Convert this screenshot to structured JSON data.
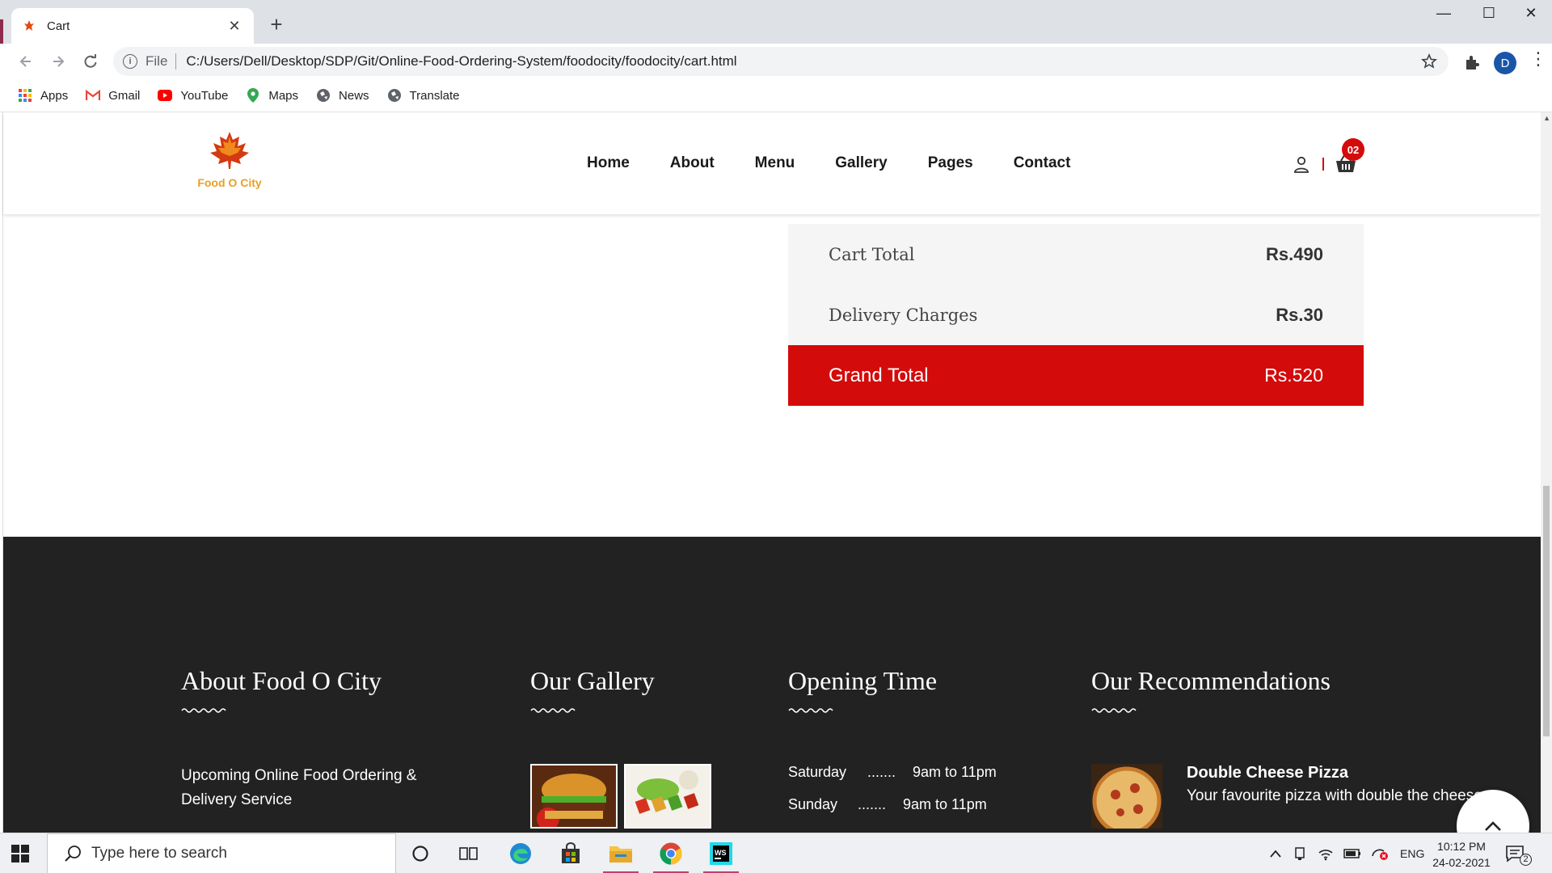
{
  "browser": {
    "tab_title": "Cart",
    "new_tab_label": "+",
    "address_scheme": "File",
    "address_url": "C:/Users/Dell/Desktop/SDP/Git/Online-Food-Ordering-System/foodocity/foodocity/cart.html",
    "profile_initial": "D",
    "bookmarks": [
      {
        "label": "Apps",
        "icon": "apps-grid-icon"
      },
      {
        "label": "Gmail",
        "icon": "gmail-icon"
      },
      {
        "label": "YouTube",
        "icon": "youtube-icon"
      },
      {
        "label": "Maps",
        "icon": "maps-icon"
      },
      {
        "label": "News",
        "icon": "globe-icon"
      },
      {
        "label": "Translate",
        "icon": "globe-icon"
      }
    ]
  },
  "site": {
    "logo_text": "Food O City",
    "nav": [
      "Home",
      "About",
      "Menu",
      "Gallery",
      "Pages",
      "Contact"
    ],
    "cart_count": "02",
    "brand_color": "#d40b0b"
  },
  "cart_totals": {
    "cart_total_label": "Cart Total",
    "cart_total_value": "Rs.490",
    "delivery_label": "Delivery Charges",
    "delivery_value": "Rs.30",
    "grand_label": "Grand Total",
    "grand_value": "Rs.520"
  },
  "footer": {
    "about_title": "About Food O City",
    "about_text": "Upcoming Online Food Ordering & Delivery Service",
    "gallery_title": "Our Gallery",
    "hours_title": "Opening Time",
    "hours": [
      {
        "day": "Saturday",
        "dots": ".......",
        "time": "9am to 11pm"
      },
      {
        "day": "Sunday",
        "dots": ".......",
        "time": "9am to 11pm"
      }
    ],
    "rec_title": "Our Recommendations",
    "rec_item_title": "Double Cheese Pizza",
    "rec_item_desc": "Your favourite pizza with double the cheese"
  },
  "taskbar": {
    "search_placeholder": "Type here to search",
    "language": "ENG",
    "time": "10:12 PM",
    "date": "24-02-2021",
    "notification_count": "2"
  }
}
